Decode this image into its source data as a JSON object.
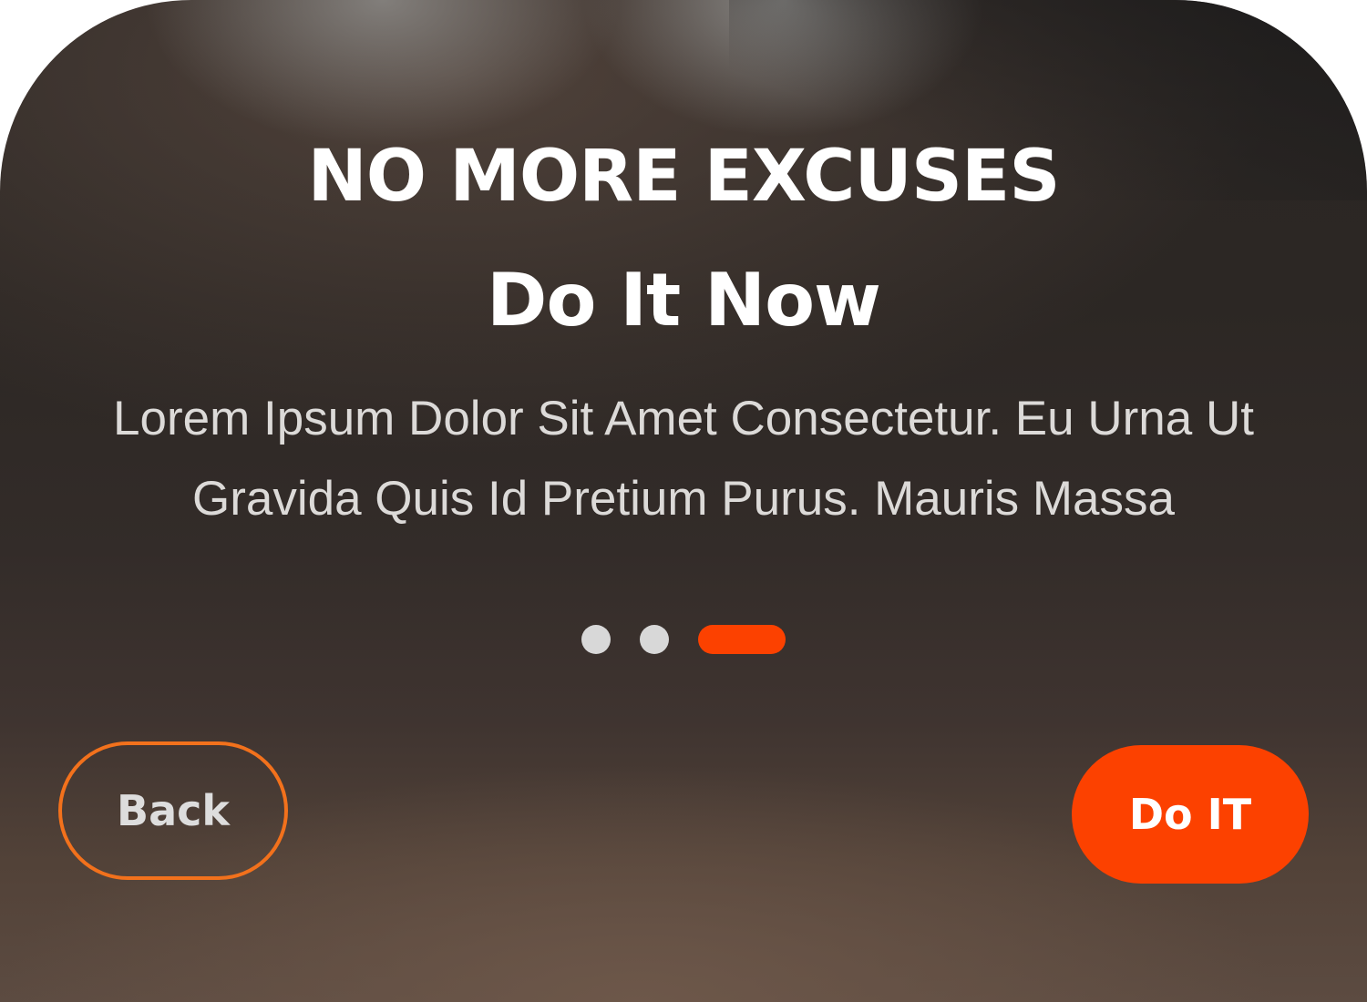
{
  "onboarding": {
    "title": "NO MORE EXCUSES",
    "subtitle": "Do It Now",
    "description": "Lorem Ipsum Dolor Sit Amet Consectetur. Eu Urna Ut Gravida Quis Id Pretium Purus. Mauris Massa",
    "pager": {
      "total_pages": 3,
      "current_page": 3
    },
    "back_button_label": "Back",
    "primary_button_label": "Do IT"
  },
  "colors": {
    "accent": "#fc4100",
    "back_border": "#f2711c",
    "inactive_dot": "#d8d8d8",
    "text_primary": "#ffffff",
    "text_secondary": "#dcdad8"
  }
}
